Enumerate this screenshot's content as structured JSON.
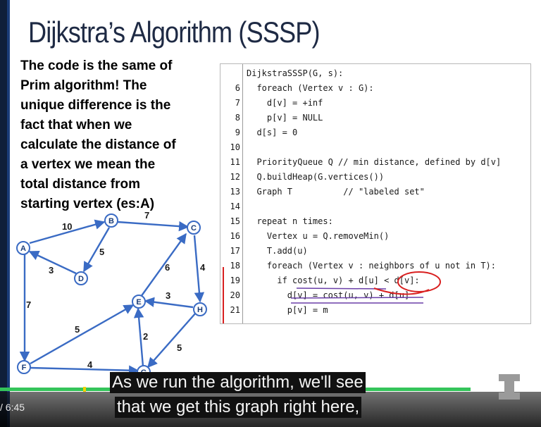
{
  "slide": {
    "title": "Dijkstra’s Algorithm (SSSP)",
    "note": "The code is the same of\nPrim algorithm! The\nunique difference is the\nfact that when we\ncalculate the distance of\na vertex we mean the\ntotal distance from\nstarting vertex (es:A)"
  },
  "code": {
    "lines": [
      {
        "no": "",
        "text": "DijkstraSSSP(G, s):"
      },
      {
        "no": "6",
        "text": "  foreach (Vertex v : G):"
      },
      {
        "no": "7",
        "text": "    d[v] = +inf"
      },
      {
        "no": "8",
        "text": "    p[v] = NULL"
      },
      {
        "no": "9",
        "text": "  d[s] = 0"
      },
      {
        "no": "10",
        "text": ""
      },
      {
        "no": "11",
        "text": "  PriorityQueue Q // min distance, defined by d[v]"
      },
      {
        "no": "12",
        "text": "  Q.buildHeap(G.vertices())"
      },
      {
        "no": "13",
        "text": "  Graph T          // \"labeled set\""
      },
      {
        "no": "14",
        "text": ""
      },
      {
        "no": "15",
        "text": "  repeat n times:"
      },
      {
        "no": "16",
        "text": "    Vertex u = Q.removeMin()"
      },
      {
        "no": "17",
        "text": "    T.add(u)"
      },
      {
        "no": "18",
        "text": "    foreach (Vertex v : neighbors of u not in T):"
      },
      {
        "no": "19",
        "text": "      if cost(u, v) + d[u] < d[v]:"
      },
      {
        "no": "20",
        "text": "        d[v] = cost(u, v) + d[u]"
      },
      {
        "no": "21",
        "text": "        p[v] = m"
      }
    ]
  },
  "graph": {
    "nodes": [
      "A",
      "B",
      "C",
      "D",
      "E",
      "F",
      "G",
      "H"
    ],
    "edge_weights": {
      "A_B": "10",
      "B_C": "7",
      "B_D": "5",
      "D_A": "3",
      "A_F": "7",
      "C_E": "6",
      "C_H": "4",
      "H_E": "3",
      "F_E": "5",
      "G_E": "2",
      "H_G": "5",
      "F_G": "4"
    }
  },
  "player": {
    "time": "/ 6:45",
    "progress": 0.87,
    "subtitle_line1": "As we run the algorithm, we'll see",
    "subtitle_line2": "that we get this graph right here,"
  },
  "colors": {
    "title": "#1e2a44",
    "graph": "#3a6bc4",
    "annotation_red": "#d92020",
    "annotation_purple": "#6a3fa8",
    "progress": "#34c45a"
  }
}
